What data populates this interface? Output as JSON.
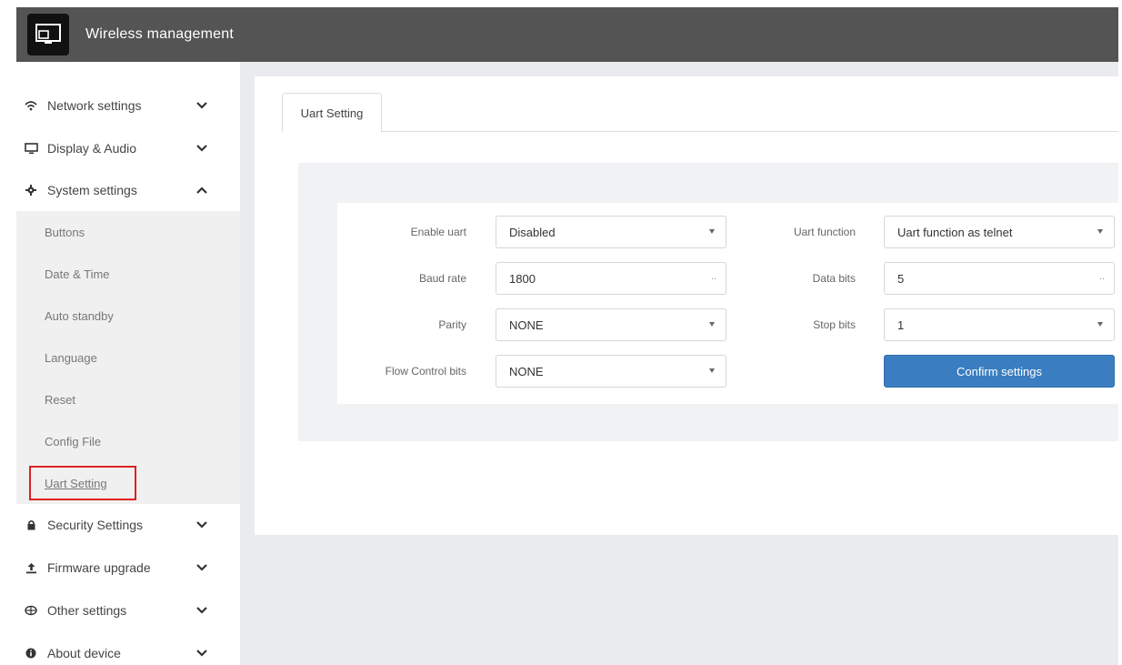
{
  "header": {
    "title": "Wireless management"
  },
  "sidebar": {
    "items": [
      {
        "label": "Network settings",
        "icon": "wifi-icon"
      },
      {
        "label": "Display & Audio",
        "icon": "monitor-icon"
      },
      {
        "label": "System settings",
        "icon": "gear-icon"
      },
      {
        "label": "Security Settings",
        "icon": "lock-icon"
      },
      {
        "label": "Firmware upgrade",
        "icon": "upload-icon"
      },
      {
        "label": "Other settings",
        "icon": "globe-icon"
      },
      {
        "label": "About device",
        "icon": "info-icon"
      }
    ],
    "submenu": [
      {
        "label": "Buttons"
      },
      {
        "label": "Date & Time"
      },
      {
        "label": "Auto standby"
      },
      {
        "label": "Language"
      },
      {
        "label": "Reset"
      },
      {
        "label": "Config File"
      },
      {
        "label": "Uart Setting"
      }
    ]
  },
  "main": {
    "tab": "Uart Setting",
    "form": {
      "enable_uart": {
        "label": "Enable uart",
        "value": "Disabled"
      },
      "uart_function": {
        "label": "Uart function",
        "value": "Uart function as telnet"
      },
      "baud_rate": {
        "label": "Baud rate",
        "value": "1800"
      },
      "data_bits": {
        "label": "Data bits",
        "value": "5"
      },
      "parity": {
        "label": "Parity",
        "value": "NONE"
      },
      "stop_bits": {
        "label": "Stop bits",
        "value": "1"
      },
      "flow_control": {
        "label": "Flow Control bits",
        "value": "NONE"
      }
    },
    "confirm_label": "Confirm settings"
  },
  "colors": {
    "header": "#545454",
    "primary_button": "#3a7dc0",
    "highlight_box": "#e02020"
  }
}
